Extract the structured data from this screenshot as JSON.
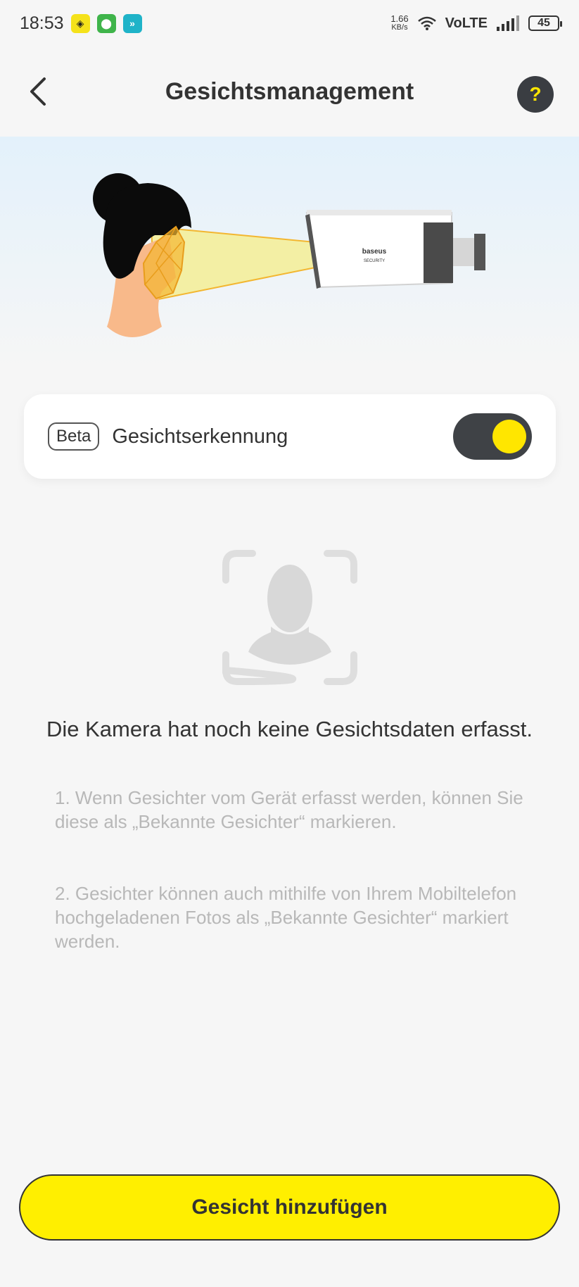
{
  "status_bar": {
    "time": "18:53",
    "net_speed_value": "1.66",
    "net_speed_unit": "KB/s",
    "network": "VoLTE",
    "battery": "45",
    "app_badges": [
      "shield-badge",
      "vpn-badge",
      "arrow-badge"
    ]
  },
  "header": {
    "title": "Gesichtsmanagement",
    "help_label": "?"
  },
  "hero": {
    "camera_brand": "baseus",
    "camera_subtitle": "SECURITY"
  },
  "toggle": {
    "badge": "Beta",
    "label": "Gesichtserkennung",
    "enabled": true
  },
  "empty_state": {
    "title": "Die Kamera hat noch keine Gesichtsdaten erfasst.",
    "hints": [
      "1. Wenn Gesichter vom Gerät erfasst werden, können Sie diese als „Bekannte Gesichter“ markieren.",
      "2. Gesichter können auch mithilfe von Ihrem Mobiltelefon hochgeladenen Fotos als „Bekannte Gesichter“ markiert werden."
    ]
  },
  "primary_action": {
    "label": "Gesicht hinzufügen"
  },
  "colors": {
    "accent": "#ffef00",
    "dark": "#3f4246",
    "hint_text": "#b8b8b8"
  }
}
